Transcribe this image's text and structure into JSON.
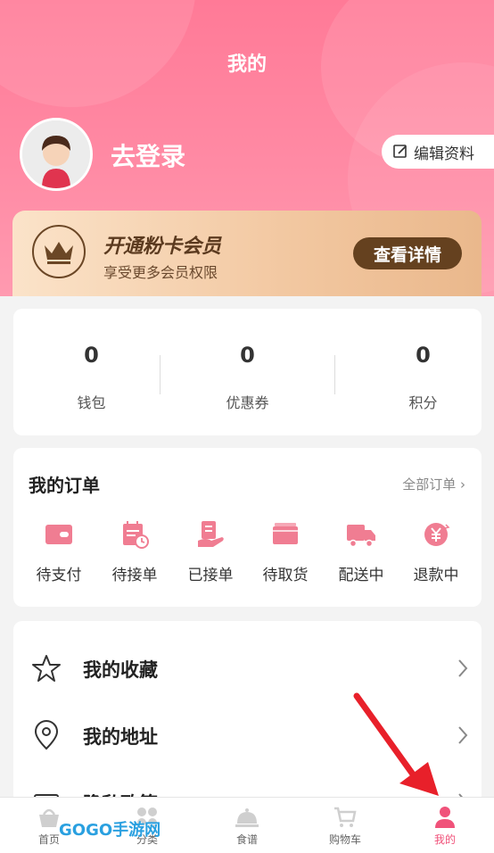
{
  "header": {
    "title": "我的",
    "login_text": "去登录",
    "edit_label": "编辑资料"
  },
  "vip": {
    "title": "开通粉卡会员",
    "subtitle": "享受更多会员权限",
    "button": "查看详情"
  },
  "stats": [
    {
      "value": "0",
      "label": "钱包"
    },
    {
      "value": "0",
      "label": "优惠券"
    },
    {
      "value": "0",
      "label": "积分"
    }
  ],
  "orders": {
    "title": "我的订单",
    "all_label": "全部订单 ›",
    "items": [
      {
        "label": "待支付",
        "icon": "wallet-icon"
      },
      {
        "label": "待接单",
        "icon": "calendar-clock-icon"
      },
      {
        "label": "已接单",
        "icon": "hand-receipt-icon"
      },
      {
        "label": "待取货",
        "icon": "package-icon"
      },
      {
        "label": "配送中",
        "icon": "truck-icon"
      },
      {
        "label": "退款中",
        "icon": "refund-yen-icon"
      }
    ]
  },
  "menu": [
    {
      "label": "我的收藏",
      "icon": "star-icon"
    },
    {
      "label": "我的地址",
      "icon": "location-pin-icon"
    },
    {
      "label": "隐私政策",
      "icon": "document-icon"
    }
  ],
  "tabbar": [
    {
      "label": "首页",
      "icon": "basket-icon"
    },
    {
      "label": "分类",
      "icon": "grid-icon"
    },
    {
      "label": "食谱",
      "icon": "cloche-icon"
    },
    {
      "label": "购物车",
      "icon": "cart-icon"
    },
    {
      "label": "我的",
      "icon": "user-icon",
      "active": true
    }
  ],
  "watermark": "GOGO手游网",
  "colors": {
    "accent": "#f0527a",
    "header": "#ff7a97",
    "vip_button": "#65411f",
    "icon_pink": "#f07d92"
  }
}
